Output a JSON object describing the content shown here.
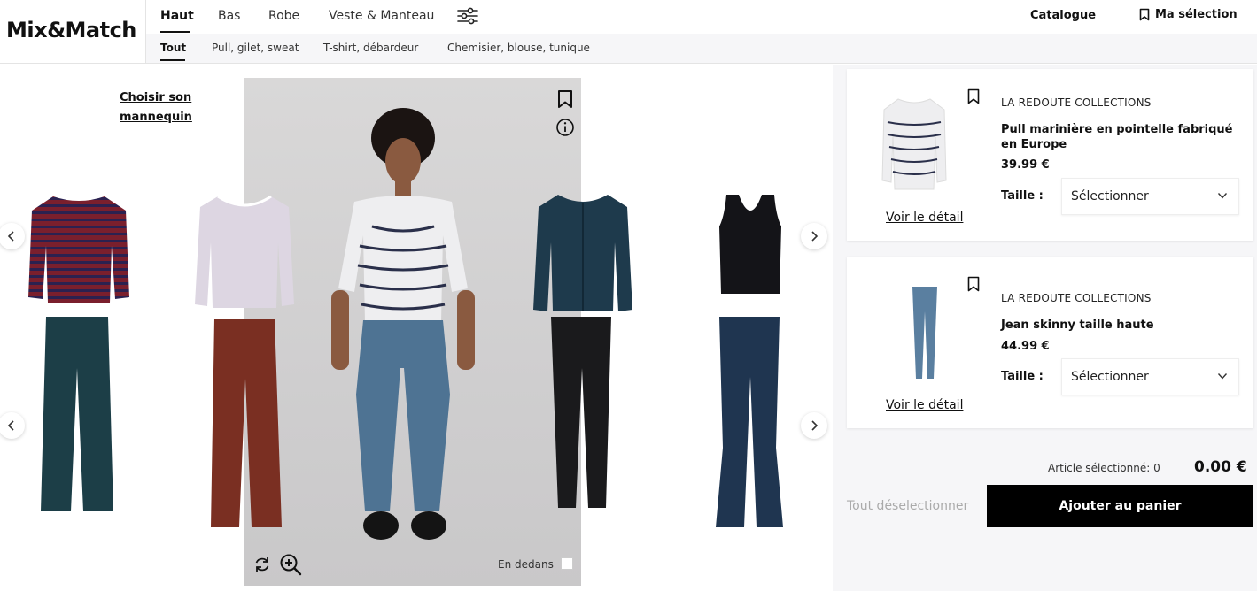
{
  "brand": {
    "logo": "Mix&Match"
  },
  "nav": {
    "categories": [
      "Haut",
      "Bas",
      "Robe",
      "Veste & Manteau"
    ],
    "active_category": "Haut",
    "subcategories": [
      "Tout",
      "Pull, gilet, sweat",
      "T-shirt, débardeur",
      "Chemisier, blouse, tunique"
    ],
    "active_subcategory": "Tout",
    "catalogue": "Catalogue",
    "ma_selection": "Ma sélection",
    "filter_icon": "sliders-icon"
  },
  "stage": {
    "choose_model": "Choisir son mannequin",
    "en_dedans": "En dedans",
    "icons": [
      "bookmark-icon",
      "info-icon",
      "rotate-icon",
      "zoom-in-icon",
      "chevron-left-icon",
      "chevron-right-icon"
    ]
  },
  "selection": {
    "items": [
      {
        "brand": "LA REDOUTE COLLECTIONS",
        "name": "Pull marinière en pointelle fabriqué en Europe",
        "price": "39.99 €",
        "size_label": "Taille :",
        "size_value": "Sélectionner",
        "detail_link": "Voir le détail"
      },
      {
        "brand": "LA REDOUTE COLLECTIONS",
        "name": "Jean skinny taille haute",
        "price": "44.99 €",
        "size_label": "Taille :",
        "size_value": "Sélectionner",
        "detail_link": "Voir le détail"
      }
    ],
    "selected_count_label": "Article sélectionné: 0",
    "total": "0.00 €",
    "deselect_all": "Tout déselectionner",
    "add_to_cart": "Ajouter au panier"
  },
  "colors": {
    "accent": "#000000",
    "panel_bg": "#f6f6f8",
    "model_bg": "#d6d5d5"
  }
}
